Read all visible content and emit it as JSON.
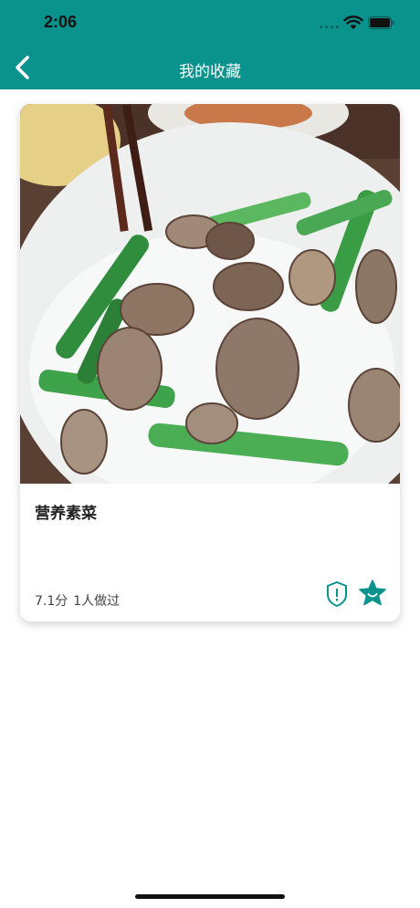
{
  "status_bar": {
    "time": "2:06"
  },
  "nav": {
    "title": "我的收藏",
    "back_icon": "chevron-left-icon"
  },
  "recipe": {
    "name": "营养素菜",
    "score": "7.1分",
    "made_count": "1人做过",
    "image_description_icon": "vegetable-dish-photo",
    "report_icon": "shield-alert-icon",
    "favorite_icon": "star-face-icon"
  },
  "colors": {
    "accent": "#0a928c",
    "background": "#ffffff"
  }
}
